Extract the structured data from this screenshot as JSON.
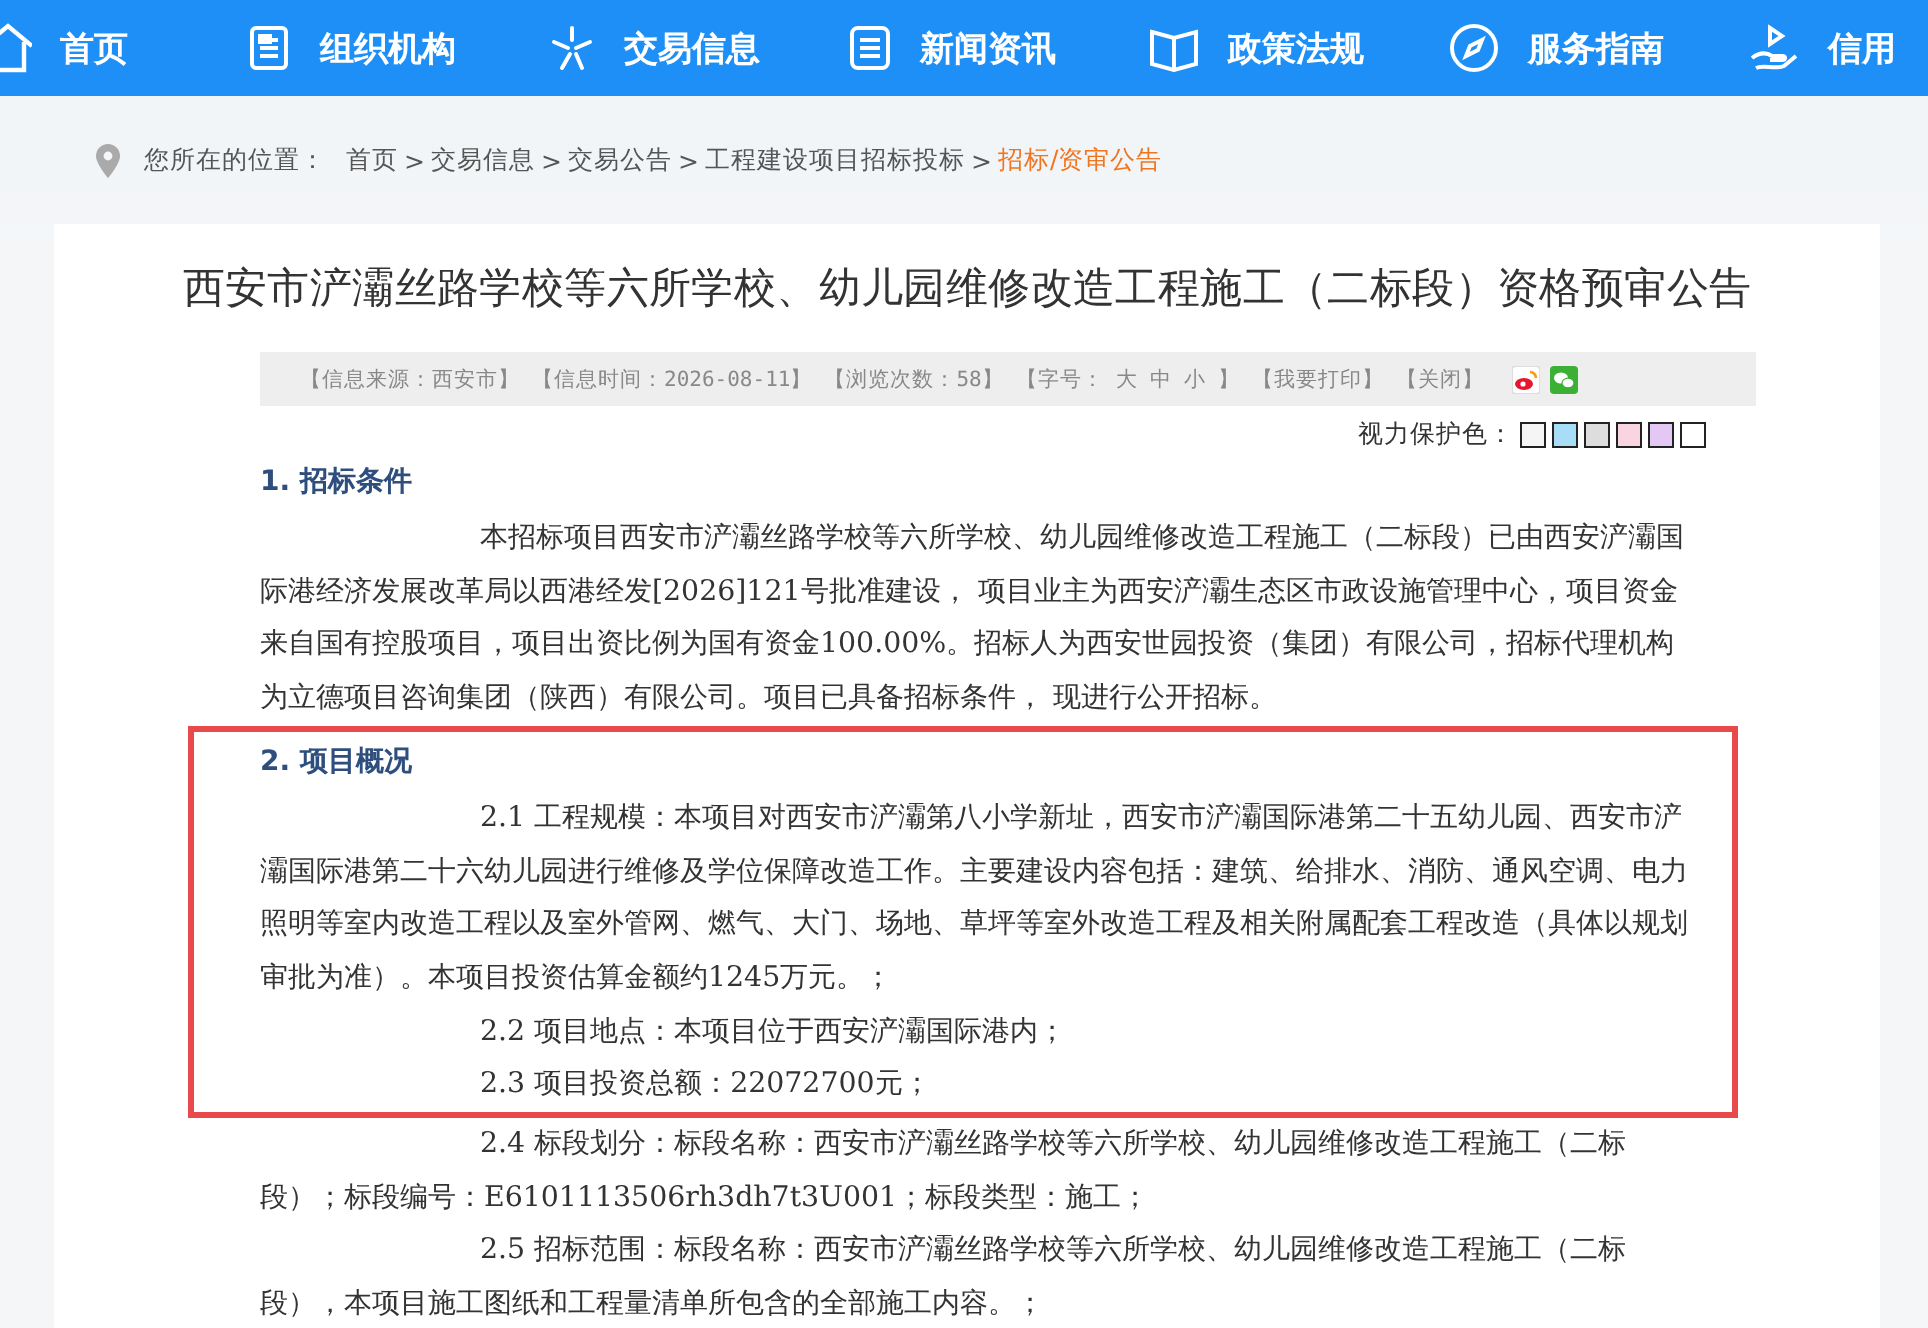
{
  "nav": [
    {
      "label": "首页"
    },
    {
      "label": "组织机构"
    },
    {
      "label": "交易信息"
    },
    {
      "label": "新闻资讯"
    },
    {
      "label": "政策法规"
    },
    {
      "label": "服务指南"
    },
    {
      "label": "信用"
    }
  ],
  "breadcrumb": {
    "prefix": "您所在的位置：",
    "separator": ">",
    "items": [
      {
        "label": "首页",
        "current": false
      },
      {
        "label": "交易信息",
        "current": false
      },
      {
        "label": "交易公告",
        "current": false
      },
      {
        "label": "工程建设项目招标投标",
        "current": false
      },
      {
        "label": "招标/资审公告",
        "current": true
      }
    ]
  },
  "article": {
    "title": "西安市浐灞丝路学校等六所学校、幼儿园维修改造工程施工（二标段）资格预审公告",
    "info": [
      "【信息来源：西安市】",
      "【信息时间：2026-08-11】",
      "【浏览次数：58】"
    ],
    "font_size": {
      "label": "【字号：",
      "sizes": [
        "大",
        "中",
        "小"
      ],
      "end": "】"
    },
    "actions": [
      "【我要打印】",
      "【关闭】"
    ],
    "share": [
      {
        "kind": "weibo"
      },
      {
        "kind": "wechat"
      }
    ],
    "eye_care": {
      "label": "视力保护色：",
      "colors": [
        {
          "color": "#f5f5f5"
        },
        {
          "color": "#a8ddf7"
        },
        {
          "color": "#dddddd"
        },
        {
          "color": "#f8d5e0"
        },
        {
          "color": "#e3c8f3"
        },
        {
          "color": "#ffffff"
        }
      ]
    },
    "sections": [
      {
        "heading": "1. 招标条件",
        "highlighted": false,
        "paragraphs": [
          {
            "text": "本招标项目西安市浐灞丝路学校等六所学校、幼儿园维修改造工程施工（二标段）已由西安浐灞国际港经济发展改革局以西港经发[2026]121号批准建设， 项目业主为西安浐灞生态区市政设施管理中心，项目资金来自国有控股项目，项目出资比例为国有资金100.00%。招标人为西安世园投资（集团）有限公司，招标代理机构为立德项目咨询集团（陕西）有限公司。项目已具备招标条件， 现进行公开招标。",
            "highlighted": false
          }
        ]
      },
      {
        "heading": "2. 项目概况",
        "highlighted": true,
        "paragraphs": [
          {
            "text": "2.1 工程规模：本项目对西安市浐灞第八小学新址，西安市浐灞国际港第二十五幼儿园、西安市浐灞国际港第二十六幼儿园进行维修及学位保障改造工作。主要建设内容包括：建筑、给排水、消防、通风空调、电力照明等室内改造工程以及室外管网、燃气、大门、场地、草坪等室外改造工程及相关附属配套工程改造（具体以规划审批为准）。本项目投资估算金额约1245万元。；",
            "highlighted": true
          },
          {
            "text": "2.2 项目地点：本项目位于西安浐灞国际港内；",
            "highlighted": true
          },
          {
            "text": "2.3 项目投资总额：22072700元；",
            "highlighted": true
          },
          {
            "text": "2.4 标段划分：标段名称：西安市浐灞丝路学校等六所学校、幼儿园维修改造工程施工（二标段）；标段编号：E6101113506rh3dh7t3U001；标段类型：施工；",
            "highlighted": false
          },
          {
            "text": "2.5 招标范围：标段名称：西安市浐灞丝路学校等六所学校、幼儿园维修改造工程施工（二标段），本项目施工图纸和工程量清单所包含的全部施工内容。；",
            "highlighted": false
          }
        ]
      }
    ]
  }
}
